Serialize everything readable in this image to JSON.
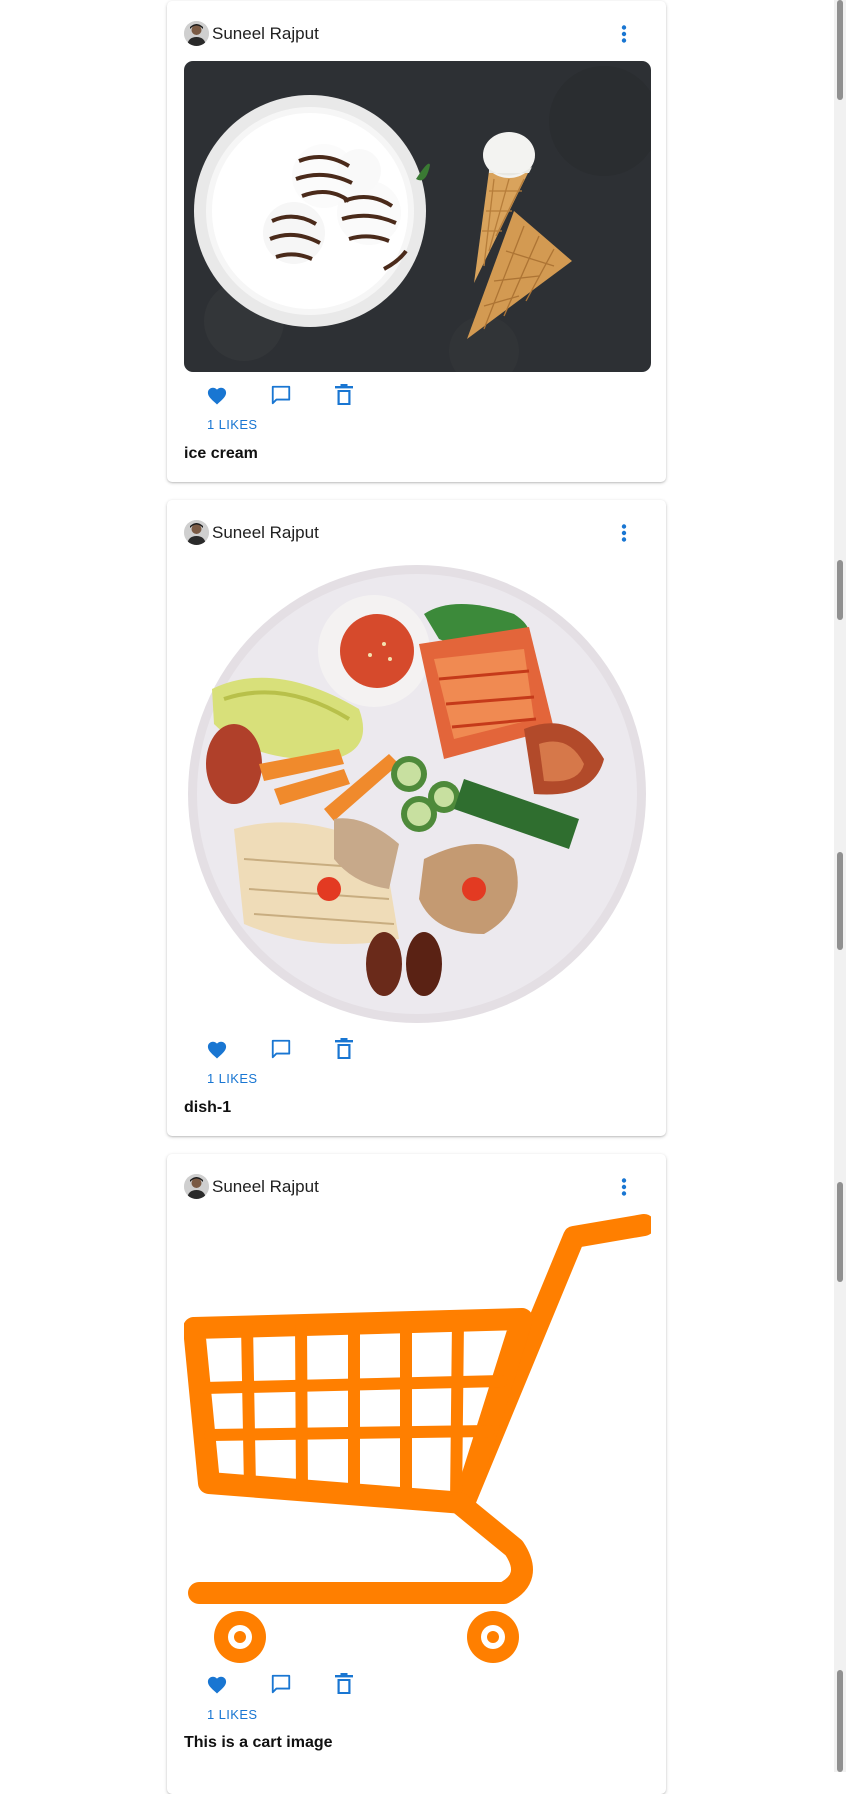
{
  "posts": [
    {
      "author": "Suneel Rajput",
      "image_alt": "ice cream",
      "likes_label": "1 LIKES",
      "caption": "ice cream"
    },
    {
      "author": "Suneel Rajput",
      "image_alt": "dish-1",
      "likes_label": "1 LIKES",
      "caption": "dish-1"
    },
    {
      "author": "Suneel Rajput",
      "image_alt": "cart image",
      "likes_label": "1 LIKES",
      "caption": "This is a cart image"
    }
  ],
  "icons": {
    "more": "more-vert-icon",
    "like": "heart-icon",
    "comment": "comment-icon",
    "delete": "trash-icon"
  },
  "colors": {
    "accent": "#1976d2",
    "cart_orange": "#ff7f00",
    "ice_cream_bg": "#2d3034"
  }
}
